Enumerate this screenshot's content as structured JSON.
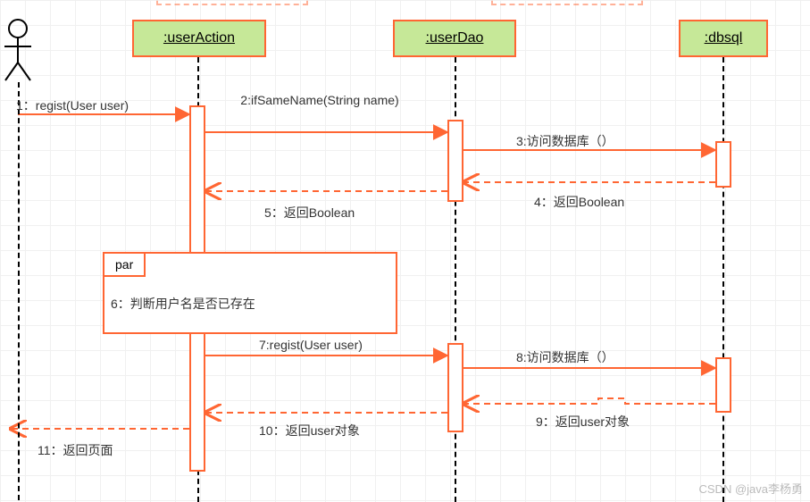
{
  "lifelines": {
    "userAction": ":userAction",
    "userDao": ":userDao",
    "dbsql": ":dbsql"
  },
  "fragment": {
    "par_label": "par"
  },
  "messages": {
    "m1": "1：regist(User user)",
    "m2": "2:ifSameName(String name)",
    "m3": "3:访问数据库（）",
    "m4": "4：返回Boolean",
    "m5": "5：返回Boolean",
    "m6": "6：判断用户名是否已存在",
    "m7": "7:regist(User user)",
    "m8": "8:访问数据库（）",
    "m9": "9：返回user对象",
    "m10": "10：返回user对象",
    "m11": "11：返回页面"
  },
  "watermark": "CSDN @java李杨勇",
  "chart_data": {
    "type": "sequence-diagram",
    "actors": [
      "User",
      "userAction",
      "userDao",
      "dbsql"
    ],
    "fragments": [
      {
        "type": "par",
        "covers": [
          "userAction"
        ],
        "note": "判断用户名是否已存在"
      }
    ],
    "messages": [
      {
        "n": 1,
        "from": "User",
        "to": "userAction",
        "label": "regist(User user)",
        "kind": "sync"
      },
      {
        "n": 2,
        "from": "userAction",
        "to": "userDao",
        "label": "ifSameName(String name)",
        "kind": "sync"
      },
      {
        "n": 3,
        "from": "userDao",
        "to": "dbsql",
        "label": "访问数据库（）",
        "kind": "sync"
      },
      {
        "n": 4,
        "from": "dbsql",
        "to": "userDao",
        "label": "返回Boolean",
        "kind": "return"
      },
      {
        "n": 5,
        "from": "userDao",
        "to": "userAction",
        "label": "返回Boolean",
        "kind": "return"
      },
      {
        "n": 6,
        "from": "userAction",
        "to": "userAction",
        "label": "判断用户名是否已存在",
        "kind": "self"
      },
      {
        "n": 7,
        "from": "userAction",
        "to": "userDao",
        "label": "regist(User user)",
        "kind": "sync"
      },
      {
        "n": 8,
        "from": "userDao",
        "to": "dbsql",
        "label": "访问数据库（）",
        "kind": "sync"
      },
      {
        "n": 9,
        "from": "dbsql",
        "to": "userDao",
        "label": "返回user对象",
        "kind": "return"
      },
      {
        "n": 10,
        "from": "userDao",
        "to": "userAction",
        "label": "返回user对象",
        "kind": "return"
      },
      {
        "n": 11,
        "from": "userAction",
        "to": "User",
        "label": "返回页面",
        "kind": "return"
      }
    ]
  }
}
